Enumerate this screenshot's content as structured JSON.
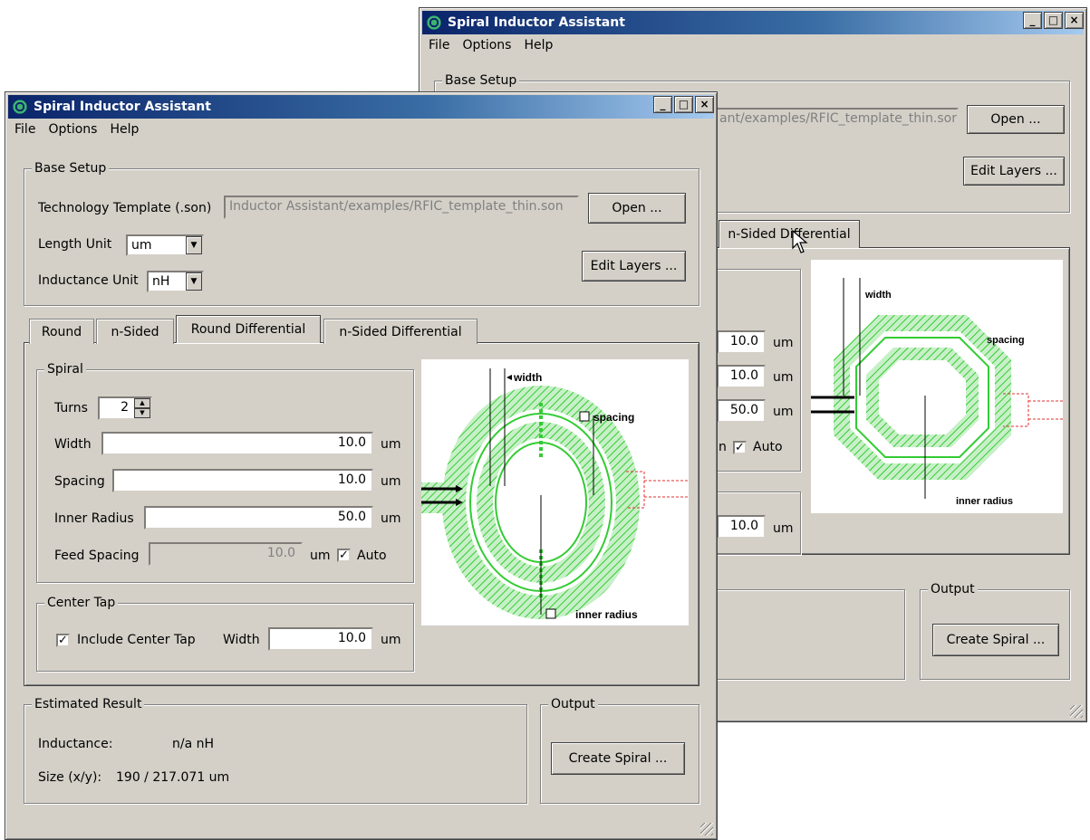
{
  "back_window": {
    "title": "Spiral Inductor Assistant",
    "menu": [
      "File",
      "Options",
      "Help"
    ],
    "base_setup_label": "Base Setup",
    "template_value": "ant/examples/RFIC_template_thin.son",
    "open_label": "Open ...",
    "edit_layers_label": "Edit Layers ...",
    "active_tab": "n-Sided Differential",
    "fields": [
      {
        "value": "10.0",
        "unit": "um"
      },
      {
        "value": "10.0",
        "unit": "um"
      },
      {
        "value": "50.0",
        "unit": "um"
      }
    ],
    "feed_unit_partial": "n",
    "auto_label": "Auto",
    "center_tap_width": {
      "value": "10.0",
      "unit": "um"
    },
    "output_label": "Output",
    "create_label": "Create Spiral ...",
    "diagram": {
      "width_label": "width",
      "spacing_label": "spacing",
      "inner_radius_label": "inner radius"
    }
  },
  "front_window": {
    "title": "Spiral Inductor Assistant",
    "menu": [
      "File",
      "Options",
      "Help"
    ],
    "base_setup": {
      "label": "Base Setup",
      "template_label": "Technology Template (.son)",
      "template_value": "Inductor Assistant/examples/RFIC_template_thin.son",
      "open_label": "Open ...",
      "length_unit_label": "Length Unit",
      "length_unit_value": "um",
      "inductance_unit_label": "Inductance Unit",
      "inductance_unit_value": "nH",
      "edit_layers_label": "Edit Layers ..."
    },
    "tabs": [
      "Round",
      "n-Sided",
      "Round Differential",
      "n-Sided Differential"
    ],
    "active_tab_index": 2,
    "spiral": {
      "label": "Spiral",
      "turns_label": "Turns",
      "turns_value": "2",
      "width_label": "Width",
      "width_value": "10.0",
      "spacing_label": "Spacing",
      "spacing_value": "10.0",
      "inner_radius_label": "Inner Radius",
      "inner_radius_value": "50.0",
      "feed_spacing_label": "Feed Spacing",
      "feed_spacing_value": "10.0",
      "unit": "um",
      "auto_label": "Auto"
    },
    "center_tap": {
      "label": "Center Tap",
      "include_label": "Include Center Tap",
      "width_label": "Width",
      "width_value": "10.0",
      "unit": "um"
    },
    "diagram": {
      "width_label": "width",
      "spacing_label": "spacing",
      "inner_radius_label": "inner radius"
    },
    "estimated": {
      "label": "Estimated Result",
      "inductance_label": "Inductance:",
      "inductance_value": "n/a  nH",
      "size_label": "Size (x/y):",
      "size_value": "190 / 217.071  um"
    },
    "output": {
      "label": "Output",
      "create_label": "Create Spiral ..."
    }
  },
  "colors": {
    "titlebar_start": "#0a246a",
    "titlebar_end": "#a6caf0",
    "window_face": "#d4d0c8",
    "spiral_green": "#33cc33",
    "feed_red": "#e03030"
  }
}
